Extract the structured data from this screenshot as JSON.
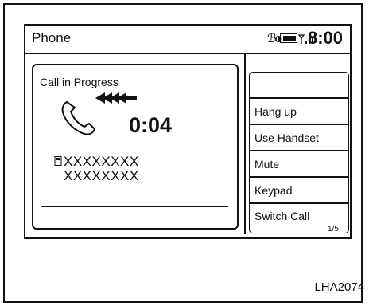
{
  "header": {
    "title": "Phone",
    "clock": "8:00",
    "bluetooth_glyph": "ℬo"
  },
  "call": {
    "status": "Call in Progress",
    "duration": "0:04",
    "contact_name": "XXXXXXXX",
    "contact_number": "XXXXXXXX"
  },
  "menu": {
    "items": [
      {
        "label": ""
      },
      {
        "label": "Hang up"
      },
      {
        "label": "Use Handset"
      },
      {
        "label": "Mute"
      },
      {
        "label": "Keypad"
      },
      {
        "label": "Switch Call"
      }
    ],
    "page_indicator": "1/5"
  },
  "figure_code": "LHA2074"
}
